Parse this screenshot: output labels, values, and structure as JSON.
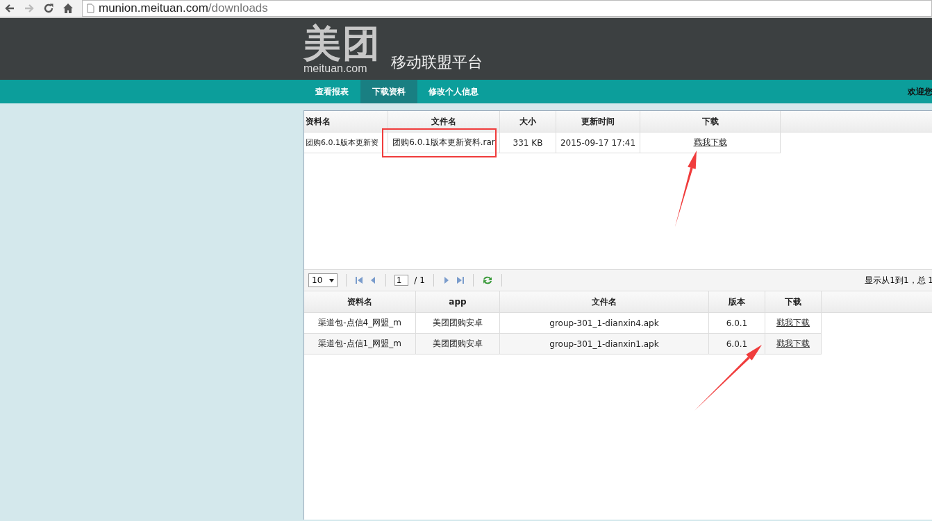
{
  "browser": {
    "url_host": "munion.meituan.com",
    "url_path": "/downloads"
  },
  "header": {
    "logo_mark": "美团",
    "logo_sub": "meituan.com",
    "platform": "移动联盟平台"
  },
  "nav": {
    "items": [
      {
        "label": "查看报表",
        "selected": false
      },
      {
        "label": "下载资料",
        "selected": true
      },
      {
        "label": "修改个人信息",
        "selected": false
      }
    ],
    "welcome": "欢迎您"
  },
  "docs_table": {
    "columns": [
      "资料名",
      "文件名",
      "大小",
      "更新时间",
      "下载"
    ],
    "rows": [
      {
        "boxed": true,
        "arrow": true,
        "cells": [
          {
            "text": "团购6.0.1版本更新资",
            "kind": "text"
          },
          {
            "text": "团购6.0.1版本更新资料.rar",
            "kind": "file"
          },
          {
            "text": "331 KB",
            "kind": "text"
          },
          {
            "text": "2015-09-17 17:41",
            "kind": "text"
          },
          {
            "text": "戳我下载",
            "kind": "link"
          }
        ]
      }
    ]
  },
  "pager": {
    "page_size": "10",
    "page": "1",
    "total_pages": "/ 1",
    "summary": "显示从1到1，总 1"
  },
  "apps_table": {
    "columns": [
      "资料名",
      "app",
      "文件名",
      "版本",
      "下载"
    ],
    "rows": [
      {
        "boxed": false,
        "arrow": false,
        "cells": [
          {
            "text": "渠道包-点信4_网盟_m",
            "kind": "text"
          },
          {
            "text": "美团团购安卓",
            "kind": "text"
          },
          {
            "text": "group-301_1-dianxin4.apk",
            "kind": "file"
          },
          {
            "text": "6.0.1",
            "kind": "text"
          },
          {
            "text": "戳我下载",
            "kind": "link"
          }
        ]
      },
      {
        "boxed": false,
        "arrow": true,
        "cells": [
          {
            "text": "渠道包-点信1_网盟_m",
            "kind": "text"
          },
          {
            "text": "美团团购安卓",
            "kind": "text"
          },
          {
            "text": "group-301_1-dianxin1.apk",
            "kind": "file"
          },
          {
            "text": "6.0.1",
            "kind": "text"
          },
          {
            "text": "戳我下载",
            "kind": "link"
          }
        ]
      }
    ]
  }
}
